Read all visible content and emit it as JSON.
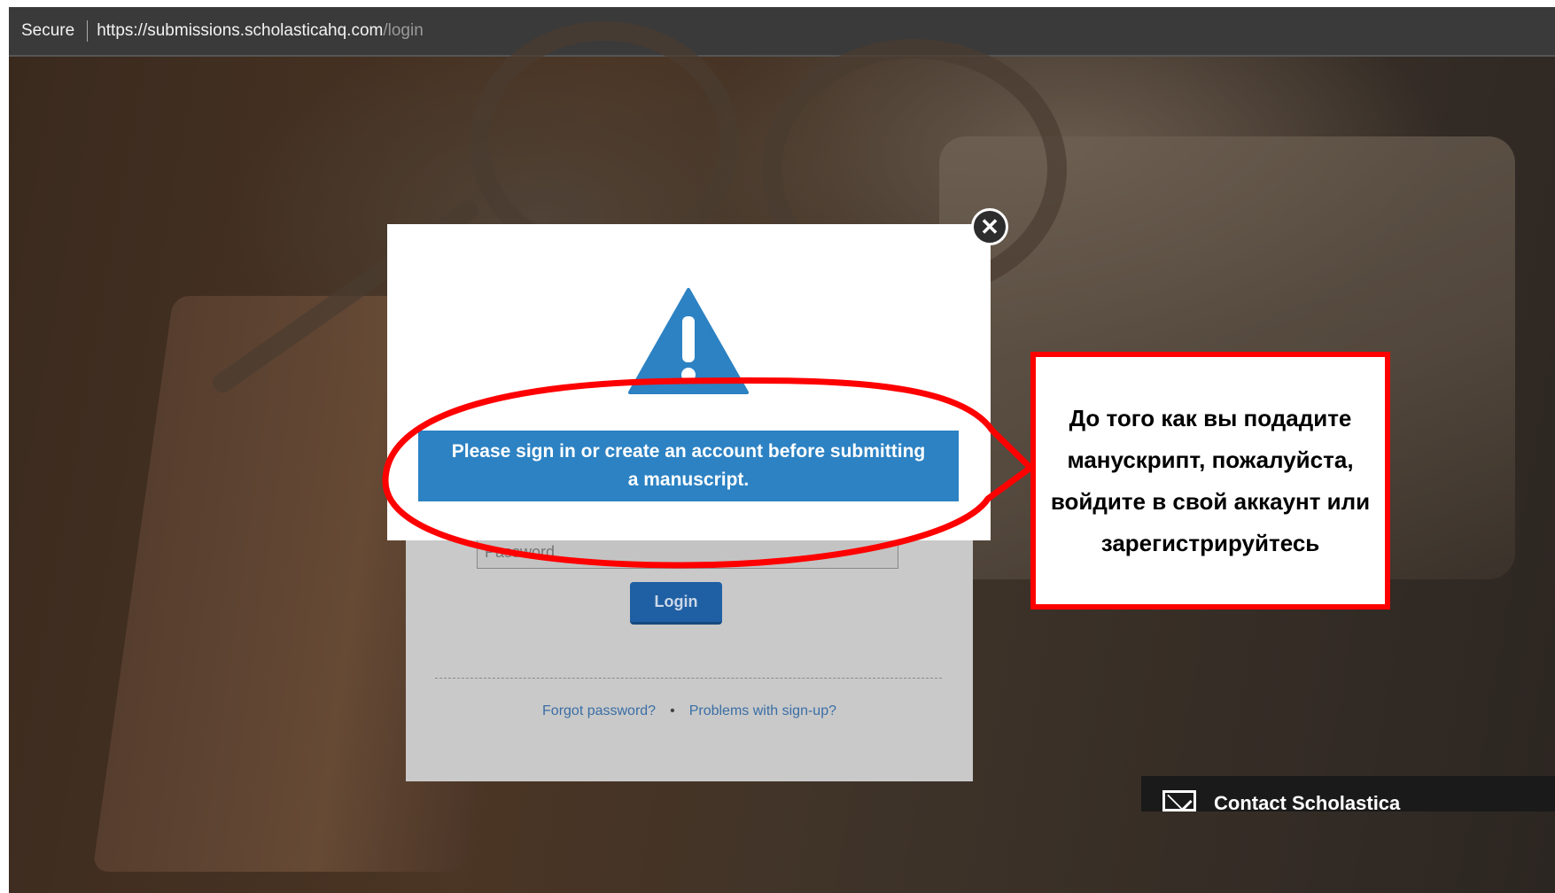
{
  "browser": {
    "secure_label": "Secure",
    "url_host": "https://submissions.scholasticahq.com",
    "url_path": "/login"
  },
  "login_card": {
    "password_placeholder": "Password",
    "login_label": "Login",
    "forgot_password": "Forgot password?",
    "separator": "•",
    "problems_signup": "Problems with sign-up?"
  },
  "modal": {
    "message": "Please sign in or create an account before submitting a manuscript.",
    "close_glyph": "✕",
    "warning_icon": "warning-triangle-icon",
    "accent_color": "#2c82c3"
  },
  "annotation": {
    "text": "До того как вы подадите манускрипт, пожалуйста, войдите в свой аккаунт или зарегистрируйтесь",
    "border_color": "#ff0000"
  },
  "contact_widget": {
    "label": "Contact Scholastica",
    "icon": "mail-icon"
  }
}
